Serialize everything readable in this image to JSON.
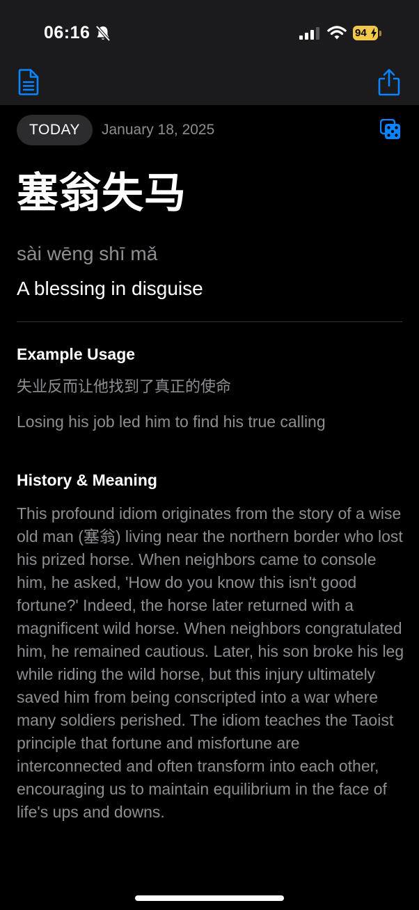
{
  "status_bar": {
    "time": "06:16",
    "battery": "94"
  },
  "header": {
    "left_icon": "document-icon",
    "right_icon": "share-icon"
  },
  "date_row": {
    "badge": "TODAY",
    "date": "January 18, 2025",
    "action_icon": "dice-icon"
  },
  "idiom": {
    "chinese": "塞翁失马",
    "pinyin": "sài wēng shī mǎ",
    "translation": "A blessing in disguise"
  },
  "example": {
    "heading": "Example Usage",
    "chinese": "失业反而让他找到了真正的使命",
    "english": "Losing his job led him to find his true calling"
  },
  "history": {
    "heading": "History & Meaning",
    "text": "This profound idiom originates from the story of a wise old man (塞翁) living near the northern border who lost his prized horse. When neighbors came to console him, he asked, 'How do you know this isn't good fortune?' Indeed, the horse later returned with a magnificent wild horse. When neighbors congratulated him, he remained cautious. Later, his son broke his leg while riding the wild horse, but this injury ultimately saved him from being conscripted into a war where many soldiers perished. The idiom teaches the Taoist principle that fortune and misfortune are interconnected and often transform into each other, encouraging us to maintain equilibrium in the face of life's ups and downs."
  },
  "colors": {
    "accent": "#0a84ff",
    "background": "#000000",
    "top_bar": "#1b1b1d",
    "secondary_text": "#8e8e93",
    "pill": "#2c2c2e",
    "battery": "#f2c84b"
  }
}
